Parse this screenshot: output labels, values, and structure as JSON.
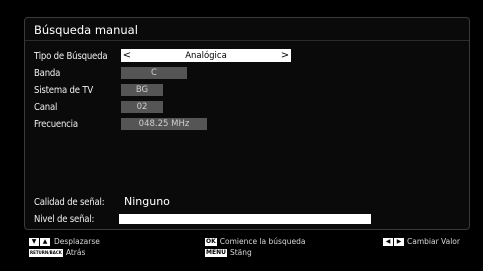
{
  "panel": {
    "title": "Búsqueda manual"
  },
  "fields": {
    "search_type": {
      "label": "Tipo de Búsqueda",
      "value": "Analógica",
      "left_arrow": "<",
      "right_arrow": ">"
    },
    "band": {
      "label": "Banda",
      "value": "C"
    },
    "tv_system": {
      "label": "Sistema de TV",
      "value": "BG"
    },
    "channel": {
      "label": "Canal",
      "value": "02"
    },
    "frequency": {
      "label": "Frecuencia",
      "value": "048.25 MHz"
    }
  },
  "signal": {
    "quality_label": "Calidad de señal:",
    "quality_value": "Ninguno",
    "level_label": "Nivel de señal:",
    "level_fraction": 1.0
  },
  "footer": {
    "move_label": "Desplazarse",
    "back_key": "RETURN/BACK",
    "back_label": "Atrás",
    "ok_key": "OK",
    "ok_label": "Comience la búsqueda",
    "menu_key": "MENU",
    "menu_label": "Stäng",
    "change_label": "Cambiar Valor"
  },
  "colors": {
    "background": "#000000",
    "panel": "#0a0a0a",
    "value_box": "#555555",
    "selected": "#ffffff"
  }
}
